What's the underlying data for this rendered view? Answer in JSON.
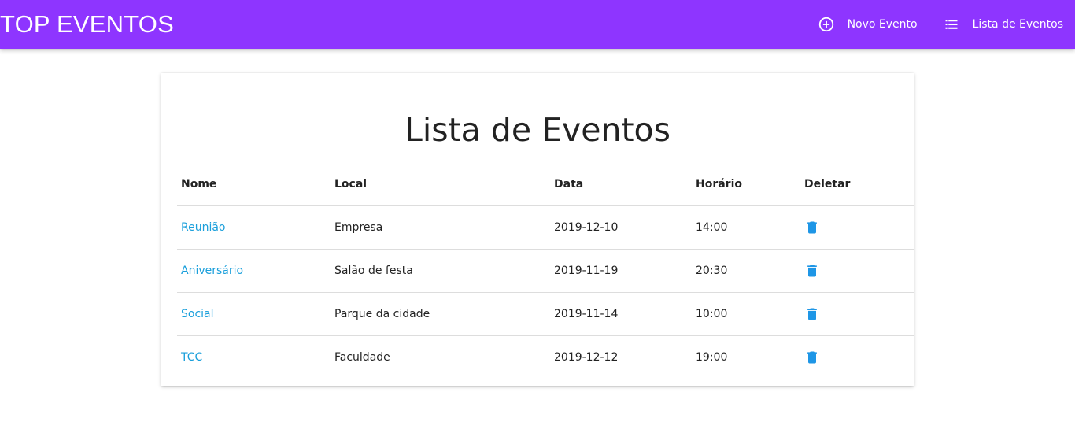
{
  "navbar": {
    "brand": "TOP EVENTOS",
    "items": [
      {
        "label": "Novo Evento",
        "icon": "add-circle-icon"
      },
      {
        "label": "Lista de Eventos",
        "icon": "list-icon"
      }
    ],
    "color": "#8e35ff"
  },
  "main": {
    "title": "Lista de Eventos",
    "headers": {
      "nome": "Nome",
      "local": "Local",
      "data": "Data",
      "horario": "Horário",
      "deletar": "Deletar"
    },
    "rows": [
      {
        "nome": "Reunião",
        "local": "Empresa",
        "data": "2019-12-10",
        "horario": "14:00"
      },
      {
        "nome": "Aniversário",
        "local": "Salão de festa",
        "data": "2019-11-19",
        "horario": "20:30"
      },
      {
        "nome": "Social",
        "local": "Parque da cidade",
        "data": "2019-11-14",
        "horario": "10:00"
      },
      {
        "nome": "TCC",
        "local": "Faculdade",
        "data": "2019-12-12",
        "horario": "19:00"
      }
    ],
    "link_color": "#1a9fdb",
    "delete_icon": "trash-icon",
    "delete_color": "#1e96e6"
  }
}
